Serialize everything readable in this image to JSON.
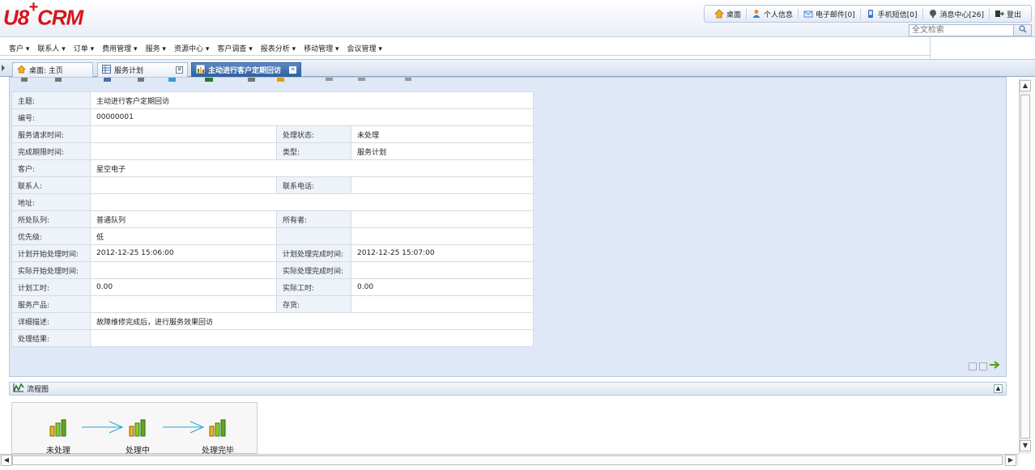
{
  "header": {
    "logo_u8": "U8",
    "logo_plus": "+",
    "logo_crm": "CRM",
    "top_links": [
      {
        "icon": "home-icon",
        "label": "桌面",
        "color": "#e0a000"
      },
      {
        "icon": "person-icon",
        "label": "个人信息",
        "color": "#e07800"
      },
      {
        "icon": "mail-icon",
        "label": "电子邮件[0]",
        "color": "#4a8ad8"
      },
      {
        "icon": "phone-icon",
        "label": "手机短信[0]",
        "color": "#3a6fb8"
      },
      {
        "icon": "message-center-icon",
        "label": "消息中心[26]",
        "color": "#333333"
      },
      {
        "icon": "logout-icon",
        "label": "登出",
        "color": "#333333"
      }
    ],
    "search_placeholder": "全文检索"
  },
  "menu": [
    "客户 ▾",
    "联系人 ▾",
    "订单 ▾",
    "费用管理 ▾",
    "服务 ▾",
    "资源中心 ▾",
    "客户调查 ▾",
    "报表分析 ▾",
    "移动管理 ▾",
    "会议管理 ▾"
  ],
  "tabs": [
    {
      "label": "桌面: 主页",
      "icon": "home-icon"
    },
    {
      "label": "服务计划",
      "icon": "table-icon"
    },
    {
      "label": "主动进行客户定期回访",
      "icon": "chart-icon"
    }
  ],
  "form": {
    "subject_label": "主题:",
    "subject_value": "主动进行客户定期回访",
    "number_label": "编号:",
    "number_value": "00000001",
    "request_time_label": "服务请求时间:",
    "request_time_value": "",
    "status_label": "处理状态:",
    "status_value": "未处理",
    "deadline_label": "完成期限时间:",
    "deadline_value": "",
    "type_label": "类型:",
    "type_value": "服务计划",
    "customer_label": "客户:",
    "customer_value": "星空电子",
    "contact_label": "联系人:",
    "contact_value": "",
    "phone_label": "联系电话:",
    "phone_value": "",
    "address_label": "地址:",
    "address_value": "",
    "queue_label": "所处队列:",
    "queue_value": "普通队列",
    "owner_label": "所有者:",
    "owner_value": "",
    "priority_label": "优先级:",
    "priority_value": "低",
    "plan_start_label": "计划开始处理时间:",
    "plan_start_value": "2012-12-25 15:06:00",
    "plan_end_label": "计划处理完成时间:",
    "plan_end_value": "2012-12-25 15:07:00",
    "actual_start_label": "实际开始处理时间:",
    "actual_start_value": "",
    "actual_end_label": "实际处理完成时间:",
    "actual_end_value": "",
    "plan_hours_label": "计划工时:",
    "plan_hours_value": "0.00",
    "actual_hours_label": "实际工时:",
    "actual_hours_value": "0.00",
    "product_label": "服务产品:",
    "product_value": "",
    "inventory_label": "存货:",
    "inventory_value": "",
    "detail_label": "详细描述:",
    "detail_value": "故障维修完成后，进行服务效果回访",
    "result_label": "处理结果:",
    "result_value": ""
  },
  "flow": {
    "title": "流程图",
    "nodes": [
      "未处理",
      "处理中",
      "处理完毕"
    ]
  },
  "colors": {
    "brand_red": "#d8141b",
    "accent_blue": "#2f5f9f",
    "panel_bg": "#dfe8f6"
  }
}
